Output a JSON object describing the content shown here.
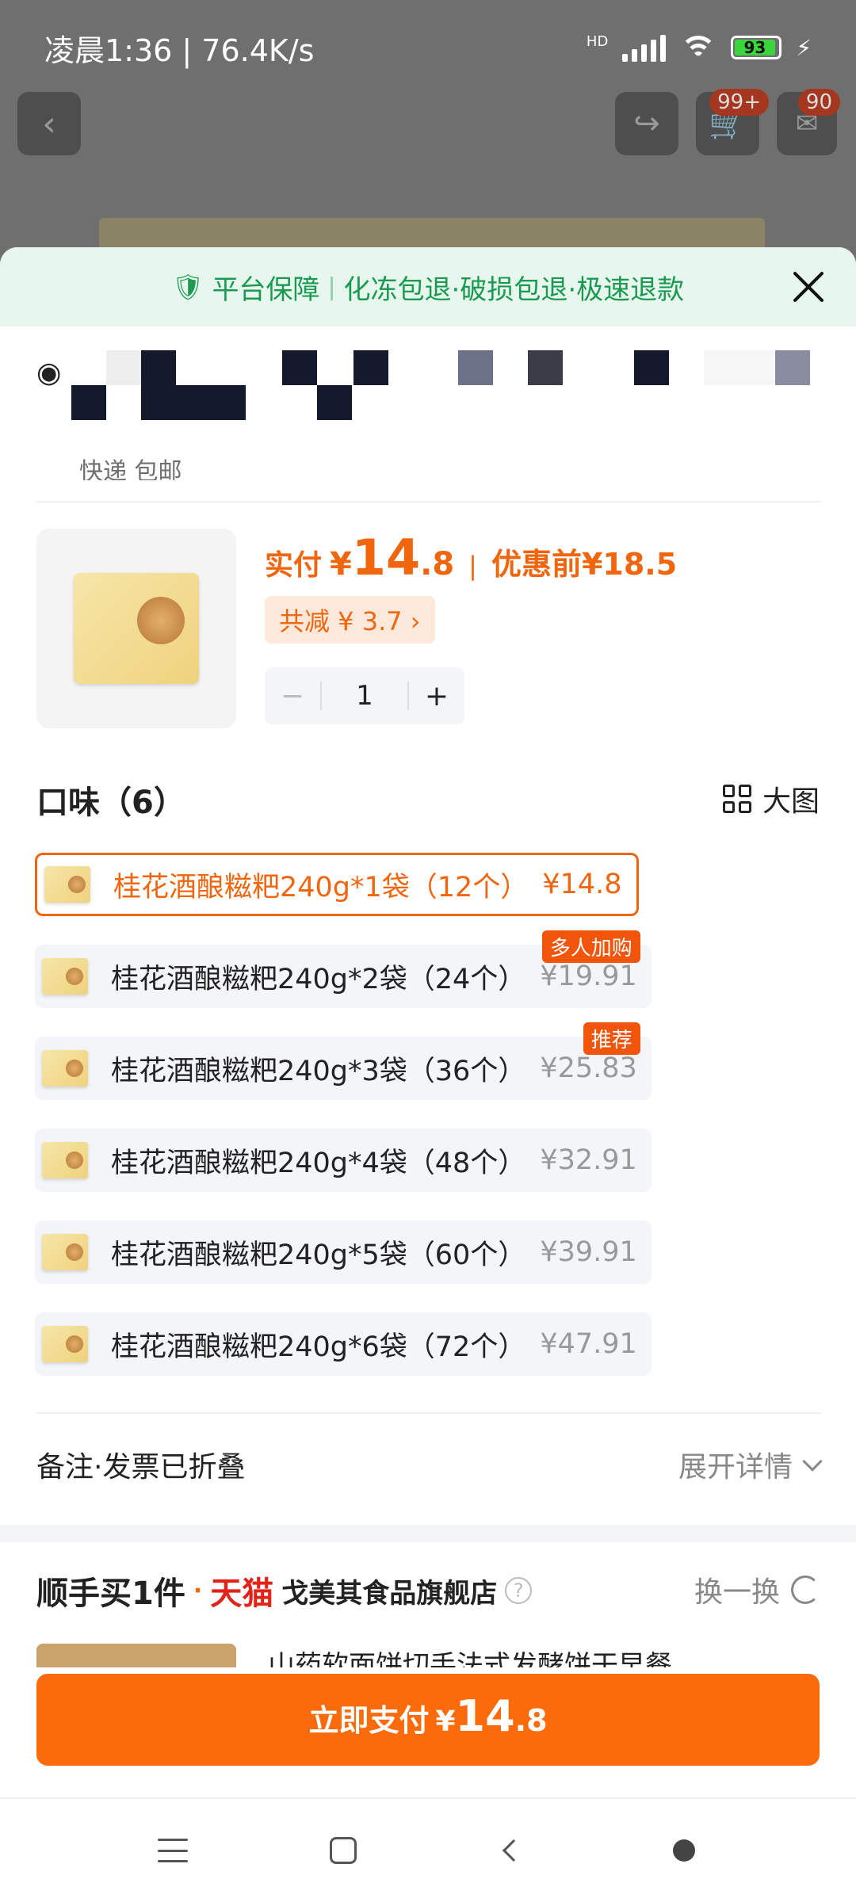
{
  "status_bar": {
    "time": "凌晨1:36 | 76.4K/s",
    "hd": "HD",
    "battery": "93"
  },
  "top_bar": {
    "cart_badge": "99+",
    "msg_badge": "90"
  },
  "guarantee": {
    "title": "平台保障",
    "items": "化冻包退·破损包退·极速退款"
  },
  "address": {
    "second_line": "快递 包邮"
  },
  "price": {
    "label": "实付",
    "yen": "¥",
    "int": "14",
    "dec": ".8",
    "before_label": "优惠前",
    "before": "¥18.5",
    "save": "共减 ¥ 3.7 ›",
    "qty": "1",
    "minus": "−",
    "plus": "+"
  },
  "flavor": {
    "title": "口味（6）",
    "view_big": "大图"
  },
  "options": [
    {
      "label": "桂花酒酿糍粑240g*1袋（12个）",
      "price": "¥14.8",
      "tag": ""
    },
    {
      "label": "桂花酒酿糍粑240g*2袋（24个）",
      "price": "¥19.91",
      "tag": "多人加购"
    },
    {
      "label": "桂花酒酿糍粑240g*3袋（36个）",
      "price": "¥25.83",
      "tag": "推荐"
    },
    {
      "label": "桂花酒酿糍粑240g*4袋（48个）",
      "price": "¥32.91",
      "tag": ""
    },
    {
      "label": "桂花酒酿糍粑240g*5袋（60个）",
      "price": "¥39.91",
      "tag": ""
    },
    {
      "label": "桂花酒酿糍粑240g*6袋（72个）",
      "price": "¥47.91",
      "tag": ""
    }
  ],
  "remark": {
    "label": "备注·发票已折叠",
    "expand": "展开详情"
  },
  "addon": {
    "title": "顺手买1件",
    "dot": "·",
    "tmall": "天猫",
    "store": "戈美其食品旗舰店",
    "help": "?",
    "swap": "换一换",
    "item_peek": "山药软面饼切手法式发酵饼干早餐"
  },
  "pay": {
    "label": "立即支付",
    "yen": "¥",
    "int": "14",
    "dec": ".8"
  },
  "colors": {
    "accent": "#fb6a0b",
    "guarantee_green": "#1b9a52",
    "tmall_red": "#e2231a"
  }
}
